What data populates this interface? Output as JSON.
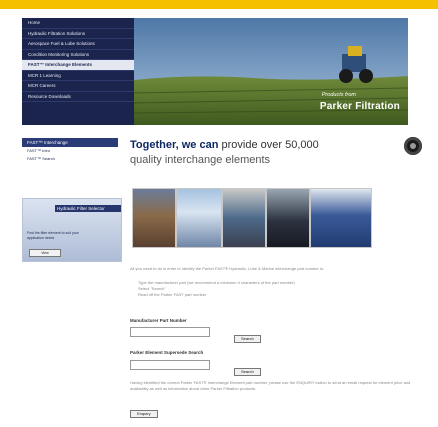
{
  "banner": {
    "nav_items": [
      "Home",
      "Hydraulic Filtration Solutions",
      "Aerospace Fuel & Lube Solutions",
      "Condition Monitoring Solutions",
      "FAST™ Interchange Elements",
      "MCR 1 Learning",
      "MCR Careers",
      "Resource Downloads"
    ],
    "active_index": 4,
    "brand_small": "Products from",
    "brand": "Parker Filtration"
  },
  "left_panel": {
    "title": "FAST™ Interchange",
    "links": [
      "FAST™ Intro",
      "FAST™ Search"
    ]
  },
  "tagline": {
    "bold": "Together, we can",
    "rest_line1": " provide over 50,000",
    "line2": "quality interchange elements"
  },
  "promo": {
    "title": "Hydraulic Filter Selector",
    "text": "Find the filter element to suit your application needs",
    "button": "View"
  },
  "content": {
    "intro": "All you need to do is enter to identify the Parker FAST® Hydraulic, Lube & Marine interchange part number is:",
    "steps": [
      "Type the manufacturer part (we recommend a minimum 4 characters of the part number)",
      "Select \"Search\"",
      "Read off the Parker FAST part number"
    ],
    "mfr_label": "Manufacturer Part Number",
    "search_label": "Search",
    "parker_label": "Parker Element Supersede Search",
    "search2_label": "Search",
    "footer_note": "Having identified the correct Parker FAST® Interchange Element part number, please use the ENQUIRY button to send an email request for element price and availability as well as information about other Parker Filtration products.",
    "enquiry_label": "Enquiry"
  },
  "colors": {
    "top_bar": "#f5c000",
    "nav_bg": "#1b244d",
    "brand_text": "#ffffff"
  }
}
